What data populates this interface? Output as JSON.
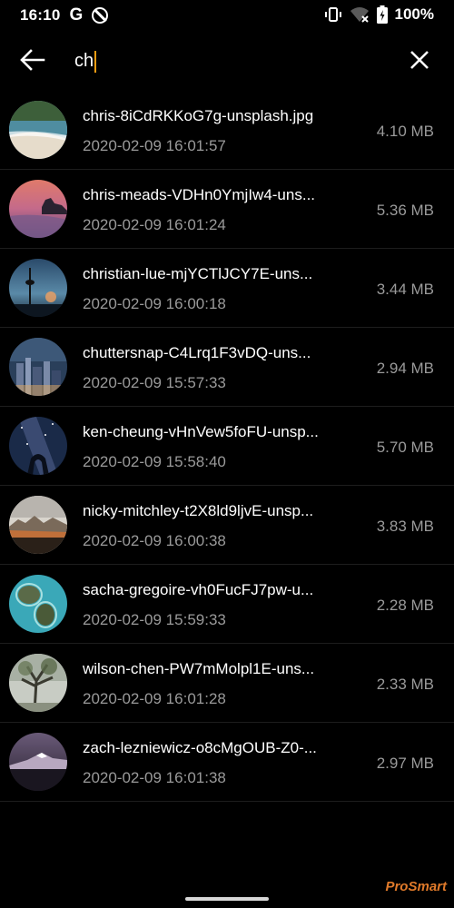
{
  "status_bar": {
    "time": "16:10",
    "g_glyph": "G",
    "battery_percent": "100%",
    "icons": [
      "google-icon",
      "dnd-icon",
      "vibrate-icon",
      "wifi-off-icon",
      "battery-icon"
    ]
  },
  "toolbar": {
    "back_icon": "arrow-left-icon",
    "search_value": "ch",
    "clear_icon": "close-icon"
  },
  "files": [
    {
      "name": "chris-8iCdRKKoG7g-unsplash.jpg",
      "date": "2020-02-09 16:01:57",
      "size": "4.10 MB",
      "thumb": "beach"
    },
    {
      "name": "chris-meads-VDHn0YmjIw4-uns...",
      "date": "2020-02-09 16:01:24",
      "size": "5.36 MB",
      "thumb": "coast-sunset"
    },
    {
      "name": "christian-lue-mjYCTlJCY7E-uns...",
      "date": "2020-02-09 16:00:18",
      "size": "3.44 MB",
      "thumb": "tower"
    },
    {
      "name": "chuttersnap-C4Lrq1F3vDQ-uns...",
      "date": "2020-02-09 15:57:33",
      "size": "2.94 MB",
      "thumb": "city-night"
    },
    {
      "name": "ken-cheung-vHnVew5foFU-unsp...",
      "date": "2020-02-09 15:58:40",
      "size": "5.70 MB",
      "thumb": "milky-way"
    },
    {
      "name": "nicky-mitchley-t2X8ld9ljvE-unsp...",
      "date": "2020-02-09 16:00:38",
      "size": "3.83 MB",
      "thumb": "landscape"
    },
    {
      "name": "sacha-gregoire-vh0FucFJ7pw-u...",
      "date": "2020-02-09 15:59:33",
      "size": "2.28 MB",
      "thumb": "islands"
    },
    {
      "name": "wilson-chen-PW7mMolpl1E-uns...",
      "date": "2020-02-09 16:01:28",
      "size": "2.33 MB",
      "thumb": "tree"
    },
    {
      "name": "zach-lezniewicz-o8cMgOUB-Z0-...",
      "date": "2020-02-09 16:01:38",
      "size": "2.97 MB",
      "thumb": "mountain"
    }
  ],
  "watermark": "ProSmart",
  "colors": {
    "background": "#000000",
    "secondary_text": "#9a9a9a",
    "cursor": "#f39c12"
  }
}
